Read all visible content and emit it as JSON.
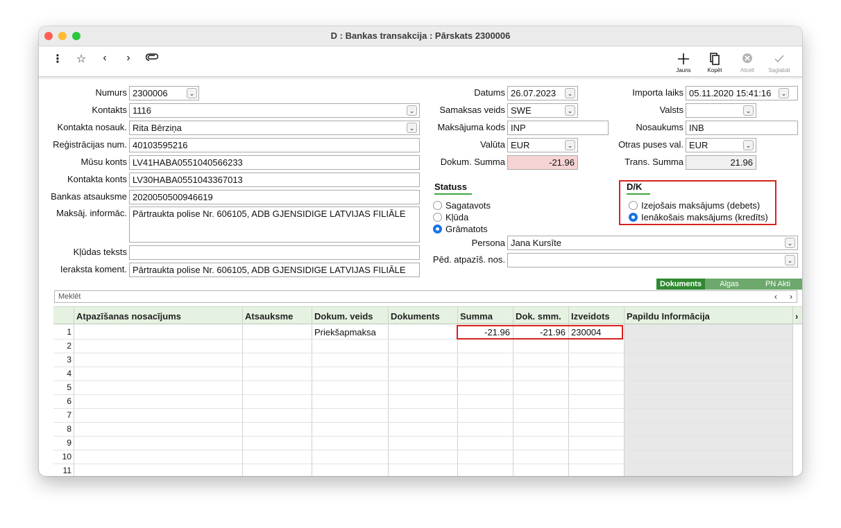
{
  "window": {
    "title": "D : Bankas transakcija : Pārskats 2300006"
  },
  "toolbar": {
    "left_icons": [
      "more-vertical-icon",
      "star-icon",
      "chevron-left-icon",
      "chevron-right-icon",
      "paperclip-icon"
    ],
    "buttons": {
      "new": "Jauns",
      "copy": "Kopēt",
      "cancel": "Atcelt",
      "save": "Saglabāt"
    }
  },
  "form": {
    "numurs": {
      "label": "Numurs",
      "value": "2300006"
    },
    "kontakts": {
      "label": "Kontakts",
      "value": "1116"
    },
    "kontakta_nosauk": {
      "label": "Kontakta nosauk.",
      "value": "Rita Bērziņa"
    },
    "registracijas_num": {
      "label": "Reģistrācijas num.",
      "value": "40103595216"
    },
    "musu_konts": {
      "label": "Mūsu konts",
      "value": "LV41HABA0551040566233"
    },
    "kontakta_konts": {
      "label": "Kontakta konts",
      "value": "LV30HABA0551043367013"
    },
    "bankas_atsauksme": {
      "label": "Bankas atsauksme",
      "value": "2020050500946619"
    },
    "maksaj_informac": {
      "label": "Maksāj. informāc.",
      "value": "Pārtraukta polise Nr. 606105, ADB GJENSIDIGE LATVIJAS FILIĀLE"
    },
    "kludas_teksts": {
      "label": "Kļūdas teksts",
      "value": ""
    },
    "ieraksta_koment": {
      "label": "Ieraksta koment.",
      "value": "Pārtraukta polise Nr. 606105, ADB GJENSIDIGE LATVIJAS FILIĀLE"
    },
    "datums": {
      "label": "Datums",
      "value": "26.07.2023"
    },
    "samaksas_veids": {
      "label": "Samaksas veids",
      "value": "SWE"
    },
    "maksajuma_kods": {
      "label": "Maksājuma kods",
      "value": "INP"
    },
    "valuta": {
      "label": "Valūta",
      "value": "EUR"
    },
    "dokum_summa": {
      "label": "Dokum. Summa",
      "value": "-21.96"
    },
    "importa_laiks": {
      "label": "Importa laiks",
      "value": "05.11.2020 15:41:16"
    },
    "valsts": {
      "label": "Valsts",
      "value": ""
    },
    "nosaukums": {
      "label": "Nosaukums",
      "value": "INB"
    },
    "otras_puses_val": {
      "label": "Otras puses val.",
      "value": "EUR"
    },
    "trans_summa": {
      "label": "Trans. Summa",
      "value": "21.96"
    },
    "persona": {
      "label": "Persona",
      "value": "Jana Kursīte"
    },
    "ped_atpazis_nos": {
      "label": "Pēd. atpazīš. nos.",
      "value": ""
    }
  },
  "statuss": {
    "title": "Statuss",
    "options": [
      "Sagatavots",
      "Kļūda",
      "Grāmatots"
    ],
    "selected": "Grāmatots"
  },
  "dk": {
    "title": "D/K",
    "options": [
      "Izejošais maksājums (debets)",
      "Ienākošais maksājums (kredīts)"
    ],
    "selected": "Ienākošais maksājums (kredīts)"
  },
  "tabs": [
    "Dokuments",
    "Algas",
    "PN Akti"
  ],
  "active_tab": "Dokuments",
  "search": {
    "label": "Meklēt"
  },
  "grid": {
    "columns": [
      "Atpazīšanas nosacījums",
      "Atsauksme",
      "Dokum. veids",
      "Dokuments",
      "Summa",
      "Dok. smm.",
      "Izveidots",
      "Papildu Informācija"
    ],
    "rows": [
      {
        "num": "1",
        "atpaz": "",
        "atsauksme": "",
        "dokum_veids": "Priekšapmaksa",
        "dokuments": "",
        "summa": "-21.96",
        "dok_smm": "-21.96",
        "izveidots": "230004",
        "papildu": ""
      },
      {
        "num": "2"
      },
      {
        "num": "3"
      },
      {
        "num": "4"
      },
      {
        "num": "5"
      },
      {
        "num": "6"
      },
      {
        "num": "7"
      },
      {
        "num": "8"
      },
      {
        "num": "9"
      },
      {
        "num": "10"
      },
      {
        "num": "11"
      }
    ]
  },
  "colors": {
    "accent_green": "#3ea63e",
    "highlight_red": "#d6221e",
    "negative_bg": "#f6d4d4"
  }
}
